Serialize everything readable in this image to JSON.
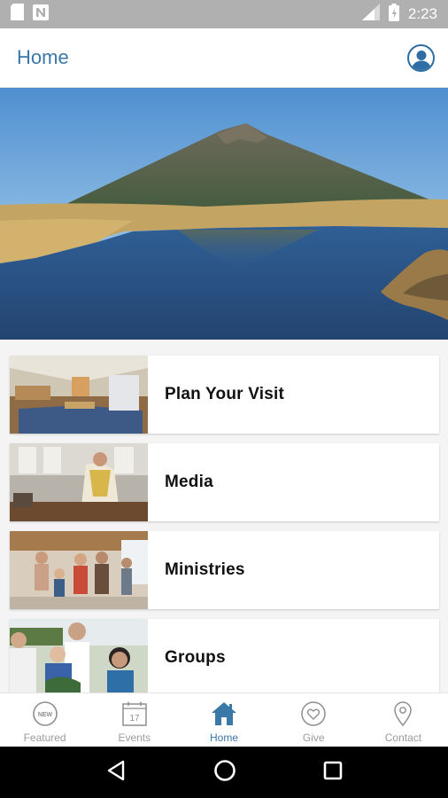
{
  "status_bar": {
    "time": "2:23"
  },
  "header": {
    "title": "Home"
  },
  "list": {
    "items": [
      {
        "label": "Plan Your Visit"
      },
      {
        "label": "Media"
      },
      {
        "label": "Ministries"
      },
      {
        "label": "Groups"
      }
    ]
  },
  "bottom_nav": {
    "items": [
      {
        "label": "Featured",
        "icon": "new-badge-icon",
        "badge_text": "NEW"
      },
      {
        "label": "Events",
        "icon": "calendar-icon",
        "day": "17"
      },
      {
        "label": "Home",
        "icon": "home-icon"
      },
      {
        "label": "Give",
        "icon": "heart-icon"
      },
      {
        "label": "Contact",
        "icon": "location-pin-icon"
      }
    ],
    "active": "Home"
  },
  "colors": {
    "accent": "#3a78a8",
    "inactive": "#9a9a9a"
  }
}
